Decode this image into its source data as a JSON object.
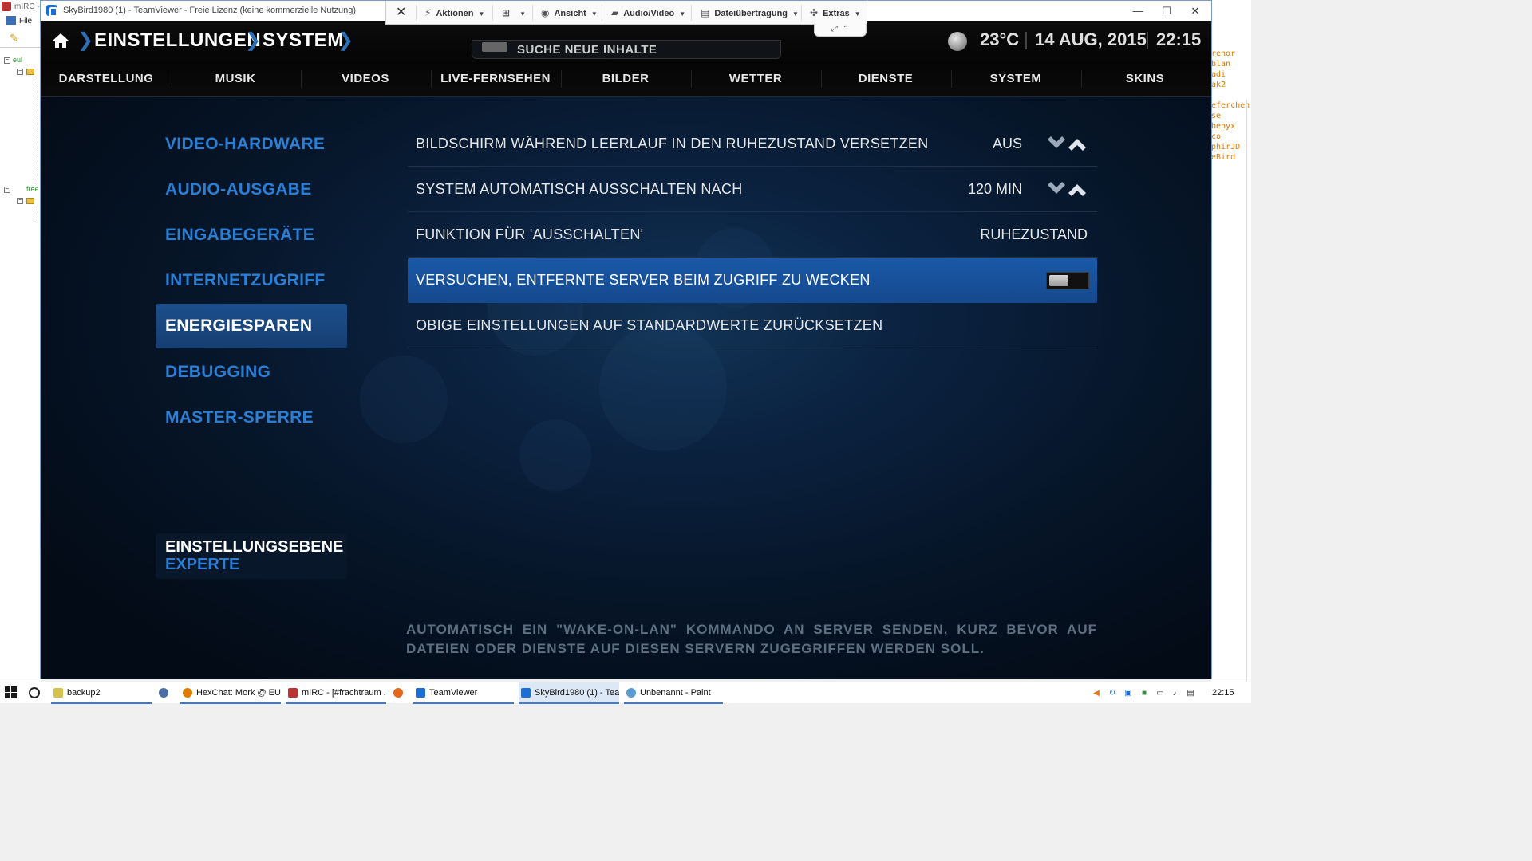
{
  "mirc": {
    "title": "mIRC -",
    "menu_file": "File",
    "tree_nodes": [
      "eul",
      "free"
    ]
  },
  "nicklist": [
    "renor",
    "blan",
    "adi",
    "ak2",
    "eferchen",
    "se",
    "benyx",
    "co",
    "phirJD",
    "eBird"
  ],
  "teamviewer": {
    "title": "SkyBird1980 (1) - TeamViewer - Freie Lizenz (keine kommerzielle Nutzung)",
    "toolbar": {
      "aktionen": "Aktionen",
      "ansicht": "Ansicht",
      "audio_video": "Audio/Video",
      "datei": "Dateiübertragung",
      "extras": "Extras"
    }
  },
  "kodi": {
    "breadcrumb": [
      "EINSTELLUNGEN",
      "SYSTEM"
    ],
    "search_label": "SUCHE NEUE INHALTE",
    "weather": {
      "temp": "23°C",
      "icon": "moon-icon"
    },
    "date": "14 AUG, 2015",
    "time": "22:15",
    "categories": [
      "DARSTELLUNG",
      "MUSIK",
      "VIDEOS",
      "LIVE-FERNSEHEN",
      "BILDER",
      "WETTER",
      "DIENSTE",
      "SYSTEM",
      "SKINS"
    ],
    "left_menu": [
      "VIDEO-HARDWARE",
      "AUDIO-AUSGABE",
      "EINGABEGERÄTE",
      "INTERNETZUGRIFF",
      "ENERGIESPAREN",
      "DEBUGGING",
      "MASTER-SPERRE"
    ],
    "left_menu_active": "ENERGIESPAREN",
    "settings": [
      {
        "label": "BILDSCHIRM WÄHREND LEERLAUF IN DEN RUHEZUSTAND VERSETZEN",
        "value": "AUS",
        "control": "spinner"
      },
      {
        "label": "SYSTEM AUTOMATISCH AUSSCHALTEN NACH",
        "value": "120 MIN",
        "control": "spinner"
      },
      {
        "label": "FUNKTION FÜR 'AUSSCHALTEN'",
        "value": "RUHEZUSTAND",
        "control": "list"
      },
      {
        "label": "VERSUCHEN, ENTFERNTE SERVER BEIM ZUGRIFF ZU WECKEN",
        "value": "off",
        "control": "toggle"
      },
      {
        "label": "OBIGE EINSTELLUNGEN AUF STANDARDWERTE ZURÜCKSETZEN",
        "control": "action"
      }
    ],
    "settings_level": {
      "title": "EINSTELLUNGSEBENE",
      "value": "EXPERTE"
    },
    "description": "AUTOMATISCH EIN \"WAKE-ON-LAN\" KOMMANDO AN SERVER SENDEN, KURZ BEVOR AUF DATEIEN ODER DIENSTE AUF DIESEN SERVERN ZUGEGRIFFEN WERDEN SOLL."
  },
  "taskbar": {
    "tasks": [
      "backup2",
      "HexChat: Mork @ EUl...",
      "mIRC - [#frachtraum ...",
      "TeamViewer",
      "SkyBird1980 (1) - Tea...",
      "Unbenannt - Paint"
    ],
    "clock": "22:15"
  },
  "colors": {
    "accent": "#2a7fd4",
    "selected": "#1a58a8",
    "background": "#061528"
  }
}
